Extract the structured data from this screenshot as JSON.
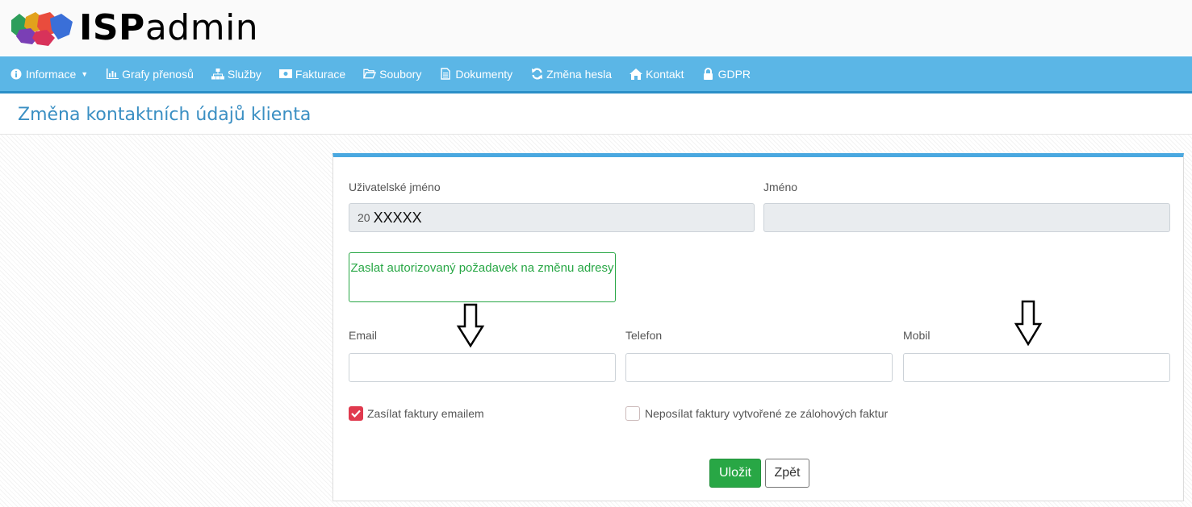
{
  "brand": {
    "bold": "ISP",
    "light": "admin"
  },
  "nav": [
    {
      "label": "Informace",
      "icon": "info-circle-icon",
      "dropdown": true
    },
    {
      "label": "Grafy přenosů",
      "icon": "bar-chart-icon"
    },
    {
      "label": "Služby",
      "icon": "sitemap-icon"
    },
    {
      "label": "Fakturace",
      "icon": "money-bill-icon"
    },
    {
      "label": "Soubory",
      "icon": "folder-open-icon"
    },
    {
      "label": "Dokumenty",
      "icon": "file-text-icon"
    },
    {
      "label": "Změna hesla",
      "icon": "refresh-icon"
    },
    {
      "label": "Kontakt",
      "icon": "home-icon"
    },
    {
      "label": "GDPR",
      "icon": "lock-icon"
    }
  ],
  "page": {
    "title": "Změna kontaktních údajů klienta"
  },
  "form": {
    "username_label": "Uživatelské jméno",
    "username_prefix": "20",
    "username_value": "XXXXX",
    "name_label": "Jméno",
    "name_value": "",
    "address_change_button": "Zaslat autorizovaný požadavek na změnu adresy",
    "email_label": "Email",
    "email_value": "",
    "phone_label": "Telefon",
    "phone_value": "",
    "mobile_label": "Mobil",
    "mobile_value": "",
    "invoice_email_label": "Zasílat faktury emailem",
    "invoice_email_checked": true,
    "no_deposit_invoices_label": "Neposílat faktury vytvořené ze zálohových faktur",
    "no_deposit_invoices_checked": false,
    "save_label": "Uložit",
    "back_label": "Zpět"
  },
  "colors": {
    "navbar": "#5bb6e6",
    "title": "#3a8fc3",
    "panel_accent": "#4aa8e0",
    "success": "#28a745",
    "checkbox_checked": "#e03a4e"
  }
}
